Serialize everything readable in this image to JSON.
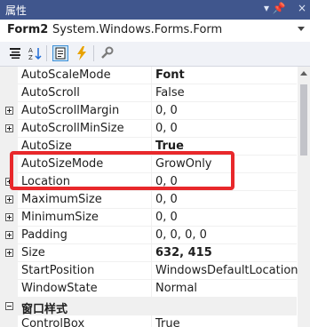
{
  "panel": {
    "title": "属性",
    "pin": "▾ 📌",
    "close": "×"
  },
  "object": {
    "name": "Form2",
    "type": "System.Windows.Forms.Form"
  },
  "toolbar": {
    "icons": [
      "categorized-icon",
      "alphabetical-icon",
      "properties-icon",
      "events-icon",
      "property-pages-icon"
    ]
  },
  "properties": [
    {
      "name": "AutoScaleMode",
      "value": "Font",
      "bold": true,
      "expandable": false
    },
    {
      "name": "AutoScroll",
      "value": "False",
      "bold": false,
      "expandable": false
    },
    {
      "name": "AutoScrollMargin",
      "value": "0, 0",
      "bold": false,
      "expandable": true
    },
    {
      "name": "AutoScrollMinSize",
      "value": "0, 0",
      "bold": false,
      "expandable": true
    },
    {
      "name": "AutoSize",
      "value": "True",
      "bold": true,
      "expandable": false
    },
    {
      "name": "AutoSizeMode",
      "value": "GrowOnly",
      "bold": false,
      "expandable": false
    },
    {
      "name": "Location",
      "value": "0, 0",
      "bold": false,
      "expandable": true
    },
    {
      "name": "MaximumSize",
      "value": "0, 0",
      "bold": false,
      "expandable": true
    },
    {
      "name": "MinimumSize",
      "value": "0, 0",
      "bold": false,
      "expandable": true
    },
    {
      "name": "Padding",
      "value": "0, 0, 0, 0",
      "bold": false,
      "expandable": true
    },
    {
      "name": "Size",
      "value": "632, 415",
      "bold": true,
      "expandable": true
    },
    {
      "name": "StartPosition",
      "value": "WindowsDefaultLocation",
      "bold": false,
      "expandable": false
    },
    {
      "name": "WindowState",
      "value": "Normal",
      "bold": false,
      "expandable": false
    }
  ],
  "category": {
    "name": "窗口样式"
  },
  "partial": {
    "name": "ControlBox",
    "value": "True"
  },
  "colors": {
    "titlebar": "#40568d",
    "highlight": "#e8282b"
  }
}
